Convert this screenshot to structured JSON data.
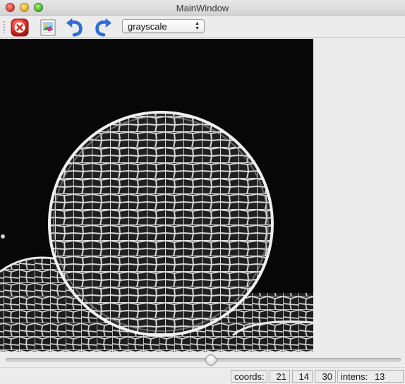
{
  "window": {
    "title": "MainWindow"
  },
  "toolbar": {
    "buttons": [
      {
        "name": "close",
        "icon": "close-x-icon"
      },
      {
        "name": "open-image",
        "icon": "image-icon"
      },
      {
        "name": "undo",
        "icon": "undo-arrow-icon"
      },
      {
        "name": "redo",
        "icon": "redo-arrow-icon"
      }
    ],
    "colormap_select": {
      "value": "grayscale"
    }
  },
  "image": {
    "description_colors": {
      "background": "#070707",
      "cell_walls": "#e6e6e6"
    }
  },
  "slider": {
    "value_fraction": 0.52
  },
  "status": {
    "coords_label": "coords:",
    "x": "21",
    "y": "14",
    "z": "30",
    "intensity_label": "intens:",
    "intensity": "13"
  },
  "colors": {
    "accent_blue": "#2f6fcf",
    "close_red": "#d9302a"
  }
}
